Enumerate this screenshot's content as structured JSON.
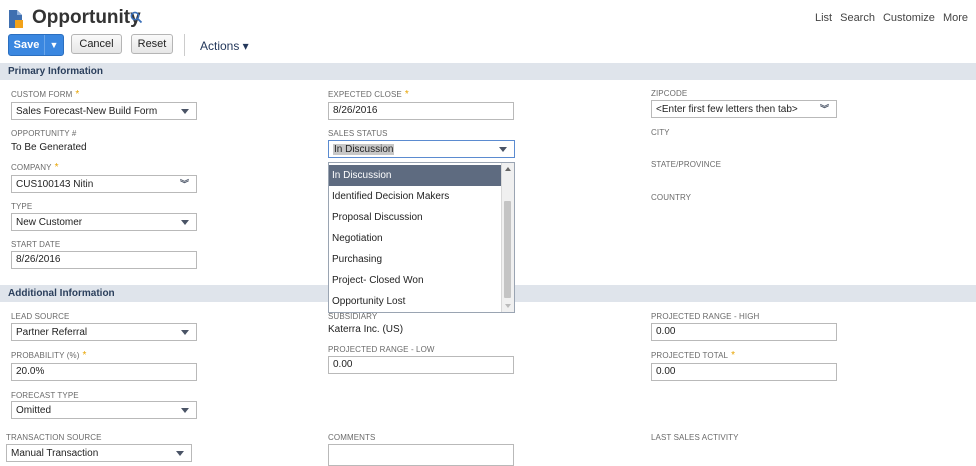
{
  "header": {
    "title": "Opportunity",
    "links": [
      "List",
      "Search",
      "Customize",
      "More"
    ]
  },
  "toolbar": {
    "save": "Save",
    "save_arrow": "▼",
    "cancel": "Cancel",
    "reset": "Reset",
    "actions": "Actions ▾"
  },
  "sections": {
    "primary": "Primary Information",
    "additional": "Additional Information"
  },
  "fields": {
    "custom_form": {
      "label": "CUSTOM FORM",
      "value": "Sales Forecast-New Build Form"
    },
    "opportunity_num": {
      "label": "OPPORTUNITY #",
      "value": "To Be Generated"
    },
    "company": {
      "label": "COMPANY",
      "value": "CUS100143 Nitin"
    },
    "type": {
      "label": "TYPE",
      "value": "New Customer"
    },
    "start_date": {
      "label": "START DATE",
      "value": "8/26/2016"
    },
    "expected_close": {
      "label": "EXPECTED CLOSE",
      "value": "8/26/2016"
    },
    "sales_status": {
      "label": "SALES STATUS",
      "value": "In Discussion"
    },
    "zipcode": {
      "label": "ZIPCODE",
      "value": "<Enter first few letters then tab>"
    },
    "city": {
      "label": "CITY"
    },
    "state": {
      "label": "STATE/PROVINCE"
    },
    "country": {
      "label": "COUNTRY"
    },
    "lead_source": {
      "label": "LEAD SOURCE",
      "value": "Partner Referral"
    },
    "probability": {
      "label": "PROBABILITY (%)",
      "value": "20.0%"
    },
    "forecast_type": {
      "label": "FORECAST TYPE",
      "value": "Omitted"
    },
    "transaction_source": {
      "label": "TRANSACTION SOURCE",
      "value": "Manual Transaction"
    },
    "subsidiary": {
      "label": "SUBSIDIARY",
      "value": "Katerra Inc. (US)"
    },
    "proj_range_low": {
      "label": "PROJECTED RANGE - LOW",
      "value": "0.00"
    },
    "comments": {
      "label": "COMMENTS",
      "value": ""
    },
    "proj_range_high": {
      "label": "PROJECTED RANGE - HIGH",
      "value": "0.00"
    },
    "proj_total": {
      "label": "PROJECTED TOTAL",
      "value": "0.00"
    },
    "last_sales_activity": {
      "label": "LAST SALES ACTIVITY"
    }
  },
  "required_marker": "*",
  "sales_status_options": [
    "In Discussion",
    "Identified Decision Makers",
    "Proposal Discussion",
    "Negotiation",
    "Purchasing",
    "Project- Closed Won",
    "Opportunity Lost"
  ],
  "colors": {
    "accent": "#3a87e0",
    "section_bg": "#dfe4eb",
    "required": "#e8a400",
    "dropdown_active": "#5e6b80"
  },
  "icons": {
    "title": "opportunity-record-icon",
    "search": "search-icon"
  }
}
